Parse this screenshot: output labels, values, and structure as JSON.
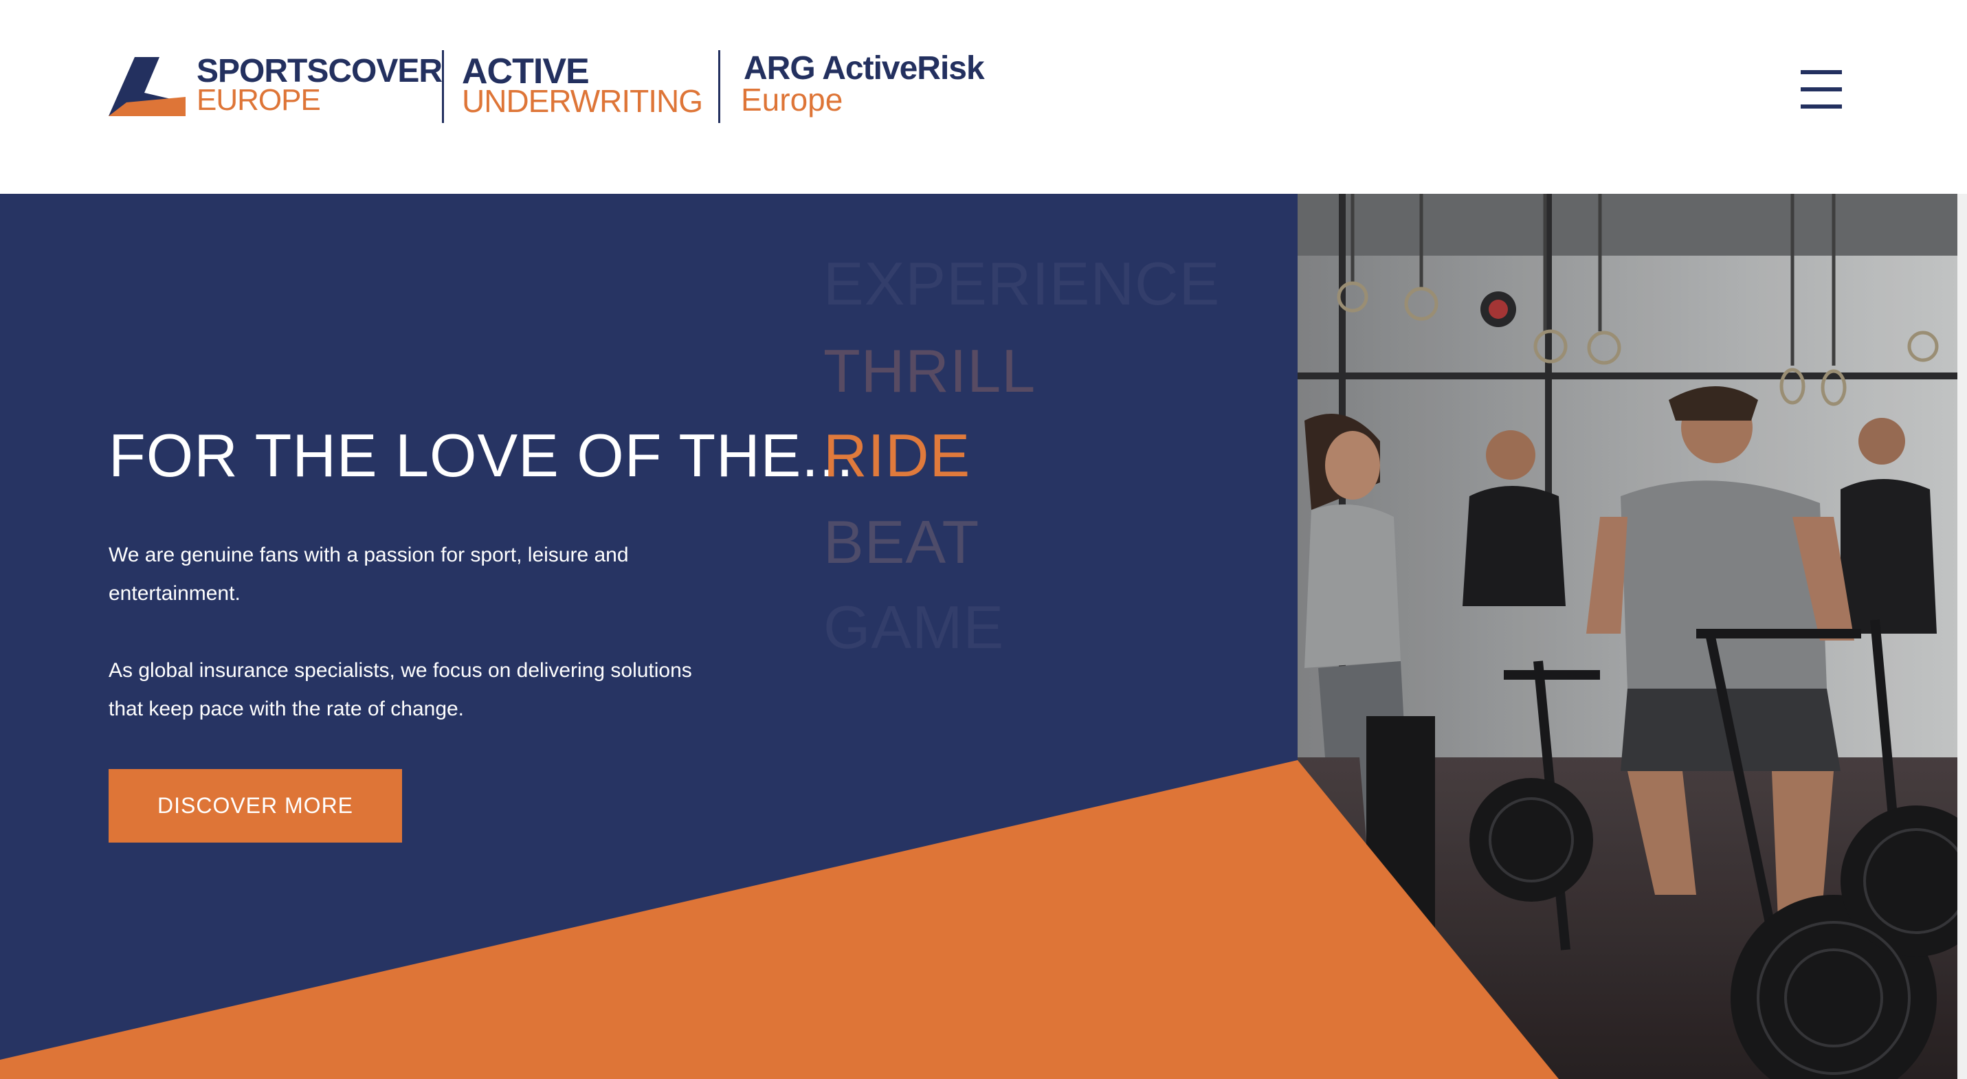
{
  "header": {
    "logos": {
      "sportscover": {
        "line1": "SPORTSCOVER",
        "line2": "EUROPE"
      },
      "active_underwriting": {
        "line1": "ACTIVE",
        "line2": "UNDERWRITING"
      },
      "arg_activerisk": {
        "line1": "ARG ActiveRisk",
        "line2": "Europe"
      }
    },
    "menu_icon": "hamburger-menu-icon"
  },
  "hero": {
    "headline_static": "FOR THE LOVE OF THE...",
    "rotating_words": [
      "EXPERIENCE",
      "THRILL",
      "RIDE",
      "BEAT",
      "GAME"
    ],
    "active_word": "RIDE",
    "paragraph1": "We are genuine fans with a passion for sport, leisure and entertainment.",
    "paragraph2": "As global insurance specialists, we focus on delivering solutions that keep pace with the rate of change.",
    "cta_label": "DISCOVER MORE",
    "photo": "people-on-air-bikes-in-gym-photo"
  },
  "colors": {
    "navy": "#273463",
    "orange": "#de7537",
    "white": "#ffffff"
  }
}
